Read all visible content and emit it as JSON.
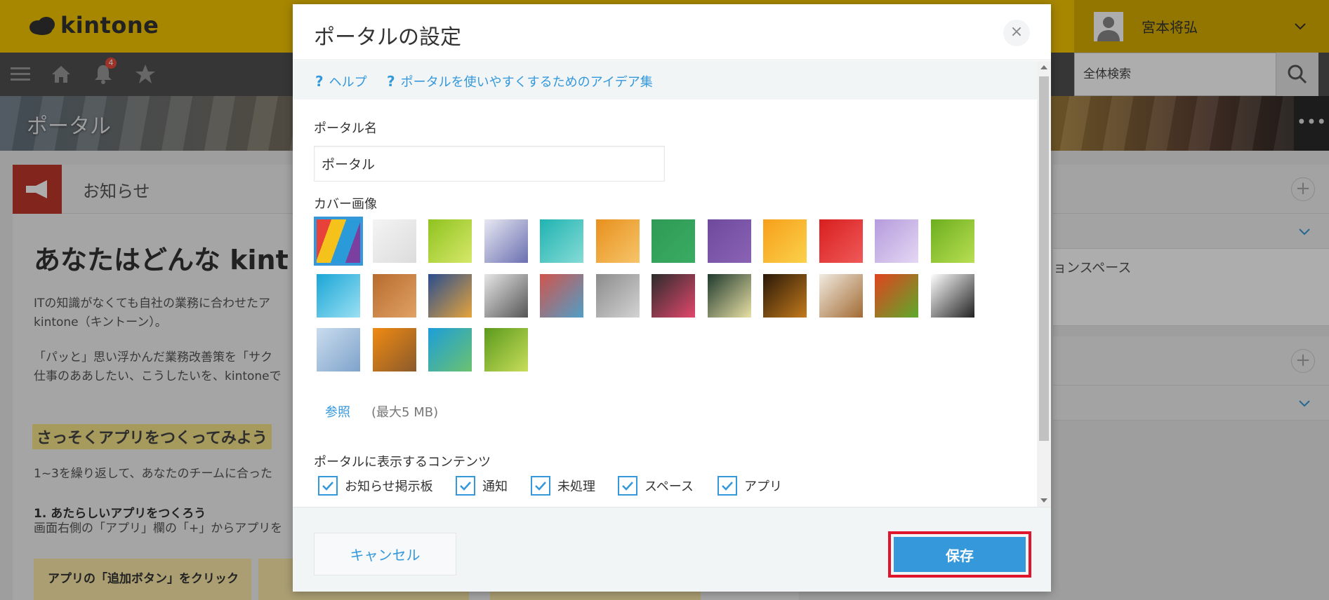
{
  "app": {
    "logo_text": "kintone",
    "user_name": "宮本将弘",
    "notification_count": "4",
    "search_placeholder": "全体検索",
    "banner_title": "ポータル",
    "banner_more": "•••"
  },
  "background": {
    "notice_title": "お知らせ",
    "big_heading": "あなたはどんな kint",
    "para1_line1": "ITの知識がなくても自社の業務に合わせたア",
    "para1_line2": "kintone（キントーン）。",
    "para2_line1": "「パッと」思い浮かんだ業務改善策を「サク",
    "para2_line2": "仕事のああしたい、こうしたいを、kintoneで",
    "sub_heading": "さっそくアプリをつくってみよう",
    "para3": "1~3を繰り返して、あなたのチームに合った",
    "step_heading": "1. あたらしいアプリをつくろう",
    "step_text": "画面右側の「アプリ」欄の「+」からアプリを",
    "card1_title": "アプリの「追加ボタン」をクリック",
    "right_text": "ョンスペース"
  },
  "modal": {
    "title": "ポータルの設定",
    "close_symbol": "×",
    "help_link_1": "ヘルプ",
    "help_link_2": "ポータルを使いやすくするためのアイデア集",
    "help_q": "?",
    "portal_name_label": "ポータル名",
    "portal_name_value": "ポータル",
    "cover_label": "カバー画像",
    "browse_label": "参照",
    "size_note": "(最大5 MB)",
    "contents_label": "ポータルに表示するコンテンツ",
    "checks": [
      {
        "label": "お知らせ掲示板",
        "checked": true
      },
      {
        "label": "通知",
        "checked": true
      },
      {
        "label": "未処理",
        "checked": true
      },
      {
        "label": "スペース",
        "checked": true
      },
      {
        "label": "アプリ",
        "checked": true
      }
    ],
    "cancel_label": "キャンセル",
    "save_label": "保存"
  },
  "covers": [
    {
      "name": "colored-pencils",
      "selected": true,
      "colors": [
        "#e8413a",
        "#f4c21b",
        "#2a9bd8",
        "#7b3fa0"
      ]
    },
    {
      "name": "white-tiles",
      "selected": false,
      "colors": [
        "#f4f4f4",
        "#dcdcdc"
      ]
    },
    {
      "name": "green-gradient",
      "selected": false,
      "colors": [
        "#8fc31f",
        "#d6e86a"
      ]
    },
    {
      "name": "purple-haze",
      "selected": false,
      "colors": [
        "#e7e8f2",
        "#6a6fb0"
      ]
    },
    {
      "name": "teal-water",
      "selected": false,
      "colors": [
        "#1fb3b2",
        "#86dbd5"
      ]
    },
    {
      "name": "orange-paint",
      "selected": false,
      "colors": [
        "#e8901d",
        "#f6c56a"
      ]
    },
    {
      "name": "green-felt",
      "selected": false,
      "colors": [
        "#2f9a55",
        "#3aac62"
      ]
    },
    {
      "name": "violet-texture",
      "selected": false,
      "colors": [
        "#6f4a9c",
        "#8a63b5"
      ]
    },
    {
      "name": "orange-flowers",
      "selected": false,
      "colors": [
        "#f79f1a",
        "#fbd14b"
      ]
    },
    {
      "name": "red-carnation",
      "selected": false,
      "colors": [
        "#d81e1e",
        "#f05a5a"
      ]
    },
    {
      "name": "lilac-flower",
      "selected": false,
      "colors": [
        "#b59bdc",
        "#e4d7f4"
      ]
    },
    {
      "name": "leaf-drops",
      "selected": false,
      "colors": [
        "#6cae1e",
        "#b9df53"
      ]
    },
    {
      "name": "blue-cubes",
      "selected": false,
      "colors": [
        "#1aa6d6",
        "#9be0f3"
      ]
    },
    {
      "name": "wicker",
      "selected": false,
      "colors": [
        "#b86b2e",
        "#e0a264"
      ]
    },
    {
      "name": "mosaic-tiles",
      "selected": false,
      "colors": [
        "#2a4d8f",
        "#e5a43b"
      ]
    },
    {
      "name": "compass",
      "selected": false,
      "colors": [
        "#e6e6e6",
        "#555555"
      ]
    },
    {
      "name": "books",
      "selected": false,
      "colors": [
        "#d1544c",
        "#4f9fc8"
      ]
    },
    {
      "name": "gears",
      "selected": false,
      "colors": [
        "#8c8c8c",
        "#d3d3d3"
      ]
    },
    {
      "name": "chalk-doodles",
      "selected": false,
      "colors": [
        "#2c2c2c",
        "#e2476c"
      ]
    },
    {
      "name": "lightbulb-chalk",
      "selected": false,
      "colors": [
        "#1f3a2e",
        "#e9e0a5"
      ]
    },
    {
      "name": "dark-amber",
      "selected": false,
      "colors": [
        "#2a1808",
        "#c27a1c"
      ]
    },
    {
      "name": "latte-art",
      "selected": false,
      "colors": [
        "#f1ebe0",
        "#a26a33"
      ]
    },
    {
      "name": "vegetables",
      "selected": false,
      "colors": [
        "#e0431f",
        "#5caa2b"
      ]
    },
    {
      "name": "french-bulldog",
      "selected": false,
      "colors": [
        "#ffffff",
        "#222222"
      ]
    },
    {
      "name": "snowy-trees",
      "selected": false,
      "colors": [
        "#c9dcee",
        "#7fa3cb"
      ]
    },
    {
      "name": "oranges-basket",
      "selected": false,
      "colors": [
        "#f08a12",
        "#8a5a2b"
      ]
    },
    {
      "name": "tropical-beach",
      "selected": false,
      "colors": [
        "#1c9ed9",
        "#6cc26f"
      ]
    },
    {
      "name": "bamboo",
      "selected": false,
      "colors": [
        "#5b9a1c",
        "#c8dd5a"
      ]
    }
  ]
}
